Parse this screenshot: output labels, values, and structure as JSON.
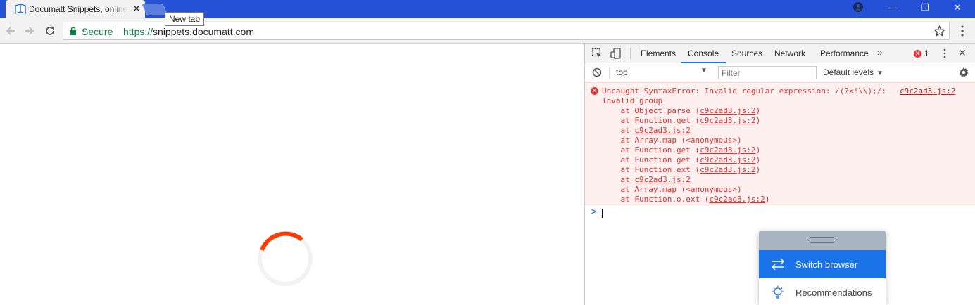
{
  "browser": {
    "tab": {
      "title": "Documatt Snippets, online"
    },
    "tooltip": "New tab",
    "omnibox": {
      "security_label": "Secure",
      "url_scheme": "https://",
      "url_host": "snippets.documatt.com"
    }
  },
  "devtools": {
    "tabs": [
      "Elements",
      "Console",
      "Sources",
      "Network",
      "Performance"
    ],
    "active_tab": "Console",
    "error_count": "1",
    "context": "top",
    "filter_placeholder": "Filter",
    "levels": "Default levels",
    "error": {
      "message_line1": "Uncaught SyntaxError: Invalid regular expression: /(?<!\\\\);/:",
      "message_line2": "Invalid group",
      "source": "c9c2ad3.js:2",
      "stack": [
        {
          "prefix": "    at Object.parse (",
          "link": "c9c2ad3.js:2",
          "suffix": ")"
        },
        {
          "prefix": "    at Function.get (",
          "link": "c9c2ad3.js:2",
          "suffix": ")"
        },
        {
          "prefix": "    at ",
          "link": "c9c2ad3.js:2",
          "suffix": ""
        },
        {
          "prefix": "    at Array.map (<anonymous>)",
          "link": "",
          "suffix": ""
        },
        {
          "prefix": "    at Function.get (",
          "link": "c9c2ad3.js:2",
          "suffix": ")"
        },
        {
          "prefix": "    at Function.get (",
          "link": "c9c2ad3.js:2",
          "suffix": ")"
        },
        {
          "prefix": "    at Function.ext (",
          "link": "c9c2ad3.js:2",
          "suffix": ")"
        },
        {
          "prefix": "    at ",
          "link": "c9c2ad3.js:2",
          "suffix": ""
        },
        {
          "prefix": "    at Array.map (<anonymous>)",
          "link": "",
          "suffix": ""
        },
        {
          "prefix": "    at Function.o.ext (",
          "link": "c9c2ad3.js:2",
          "suffix": ")"
        }
      ]
    },
    "prompt_symbol": ">"
  },
  "widget": {
    "items": [
      {
        "label": "Switch browser",
        "icon": "switch-arrows-icon",
        "active": true
      },
      {
        "label": "Recommendations",
        "icon": "lightbulb-icon",
        "active": false
      }
    ]
  },
  "colors": {
    "titlebar": "#2451d6",
    "accent": "#1a73e8",
    "error": "#e03030",
    "spinner": "#ff3d00",
    "secure": "#0b8043"
  }
}
